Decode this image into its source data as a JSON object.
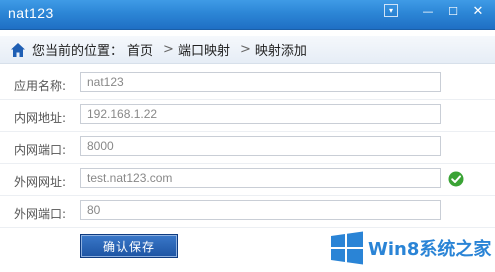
{
  "window": {
    "title": "nat123",
    "controls": {
      "dropdown": "▾",
      "minimize": "—",
      "maximize": "☐",
      "close": "✕"
    }
  },
  "breadcrumb": {
    "prefix": "您当前的位置：",
    "items": [
      "首页",
      "端口映射",
      "映射添加"
    ],
    "separator": ">"
  },
  "form": {
    "fields": [
      {
        "label": "应用名称:",
        "value": "nat123"
      },
      {
        "label": "内网地址:",
        "value": "192.168.1.22"
      },
      {
        "label": "内网端口:",
        "value": "8000"
      },
      {
        "label": "外网网址:",
        "value": "test.nat123.com",
        "status": "check-icon"
      },
      {
        "label": "外网端口:",
        "value": "80"
      }
    ],
    "save_label": "确认保存"
  },
  "watermark": {
    "text": "Win8系统之家"
  },
  "colors": {
    "titlebar": "#2c86d6",
    "button": "#1d54a3",
    "check": "#3aa335",
    "watermark": "#2a84d6"
  }
}
